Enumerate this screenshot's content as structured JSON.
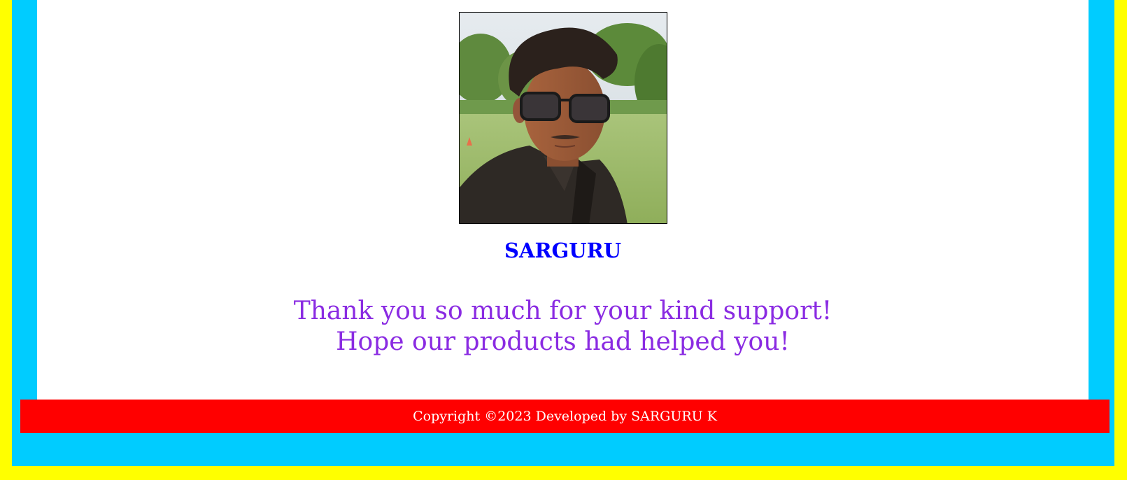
{
  "profile": {
    "name": "SARGURU"
  },
  "message": {
    "line1": "Thank you so much for your kind support!",
    "line2": "Hope our products had helped you!"
  },
  "footer": {
    "copyright": "Copyright ©2023 Developed by SARGURU K"
  },
  "colors": {
    "outer_border": "#ffff00",
    "inner_border": "#00ccff",
    "name_text": "#0000ff",
    "message_text": "#8a2be2",
    "footer_bg": "#ff0000",
    "footer_text": "#ffffff"
  }
}
